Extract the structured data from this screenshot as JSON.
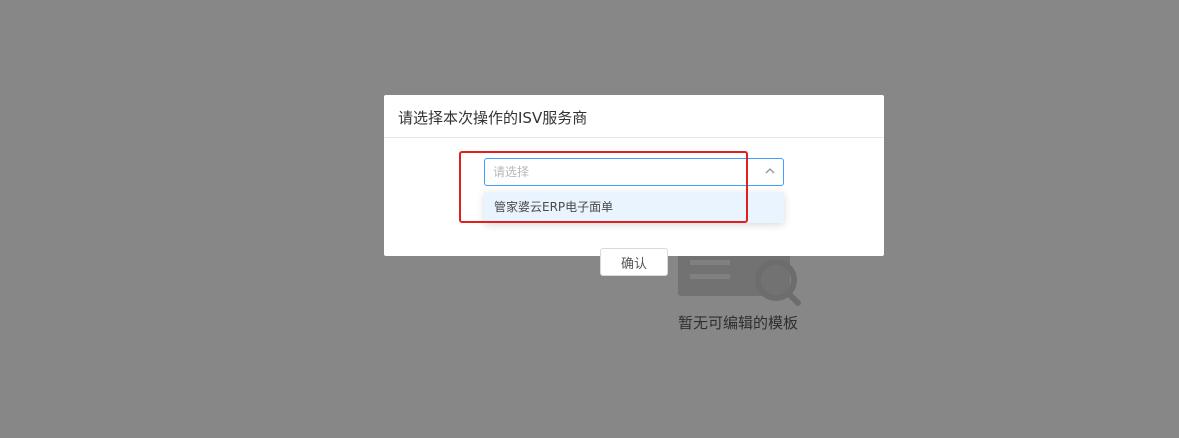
{
  "background": {
    "empty_state": {
      "icon": "document-search-icon",
      "text": "暂无可编辑的模板"
    }
  },
  "dialog": {
    "title": "请选择本次操作的ISV服务商",
    "select": {
      "placeholder": "请选择",
      "value": "",
      "expanded": true,
      "arrow_icon": "chevron-up-icon"
    },
    "confirm_label": "确认",
    "dropdown": {
      "options": [
        "管家婆云ERP电子面单"
      ]
    }
  },
  "annotation": {
    "highlight_color": "#e0201e"
  },
  "colors": {
    "accent": "#409eff",
    "mask": "rgba(0,0,0,0.47)",
    "option_hover": "#eaf4fe"
  }
}
